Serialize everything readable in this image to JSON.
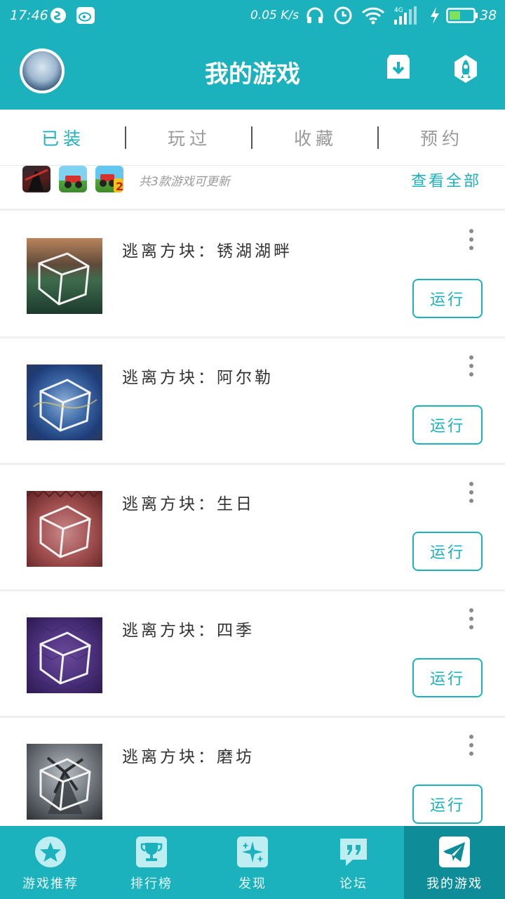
{
  "status_bar": {
    "time": "17:46",
    "speed": "0.05 K/s",
    "network": "4G",
    "battery": "38"
  },
  "header": {
    "title": "我的游戏"
  },
  "tabs": [
    {
      "label": "已装",
      "active": true
    },
    {
      "label": "玩过",
      "active": false
    },
    {
      "label": "收藏",
      "active": false
    },
    {
      "label": "预约",
      "active": false
    }
  ],
  "updates": {
    "text": "共3款游戏可更新",
    "view_all": "查看全部",
    "badge": "2"
  },
  "games": [
    {
      "name": "逃离方块：锈湖湖畔",
      "run_label": "运行"
    },
    {
      "name": "逃离方块：阿尔勒",
      "run_label": "运行"
    },
    {
      "name": "逃离方块：生日",
      "run_label": "运行"
    },
    {
      "name": "逃离方块：四季",
      "run_label": "运行"
    },
    {
      "name": "逃离方块：磨坊",
      "run_label": "运行"
    }
  ],
  "bottom_nav": [
    {
      "label": "游戏推荐",
      "icon": "star-icon",
      "active": false
    },
    {
      "label": "排行榜",
      "icon": "trophy-icon",
      "active": false
    },
    {
      "label": "发现",
      "icon": "sparkle-icon",
      "active": false
    },
    {
      "label": "论坛",
      "icon": "quote-bubble-icon",
      "active": false
    },
    {
      "label": "我的游戏",
      "icon": "paper-plane-icon",
      "active": true
    }
  ],
  "colors": {
    "accent": "#1bb1bd",
    "accent_dark": "#0e8d98"
  }
}
